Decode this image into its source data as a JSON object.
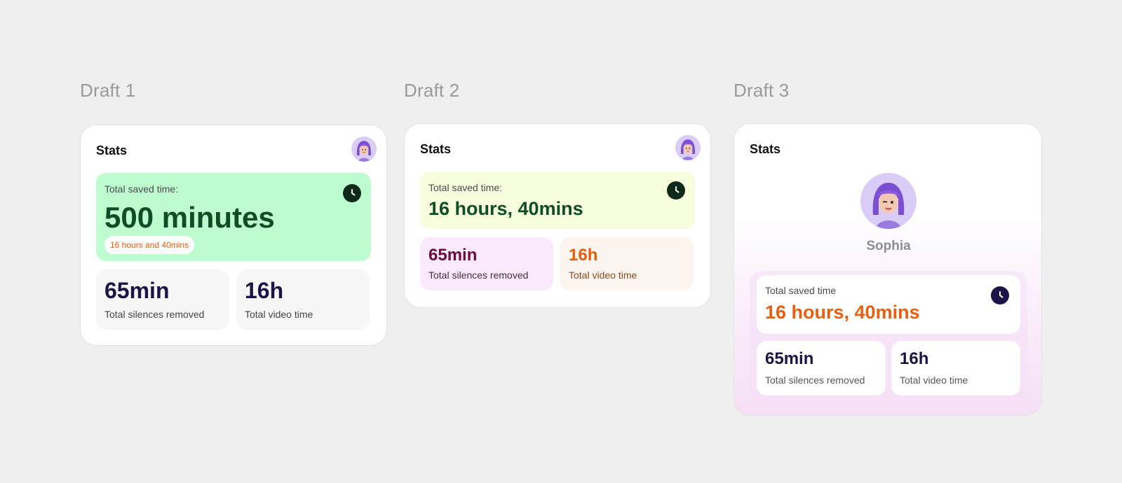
{
  "drafts": [
    {
      "title": "Draft 1",
      "card_title": "Stats",
      "saved_label": "Total saved time:",
      "saved_value": "500 minutes",
      "saved_pill": "16 hours and 40mins",
      "silences_value": "65min",
      "silences_label": "Total silences removed",
      "video_value": "16h",
      "video_label": "Total video time"
    },
    {
      "title": "Draft 2",
      "card_title": "Stats",
      "saved_label": "Total saved time:",
      "saved_value": "16 hours, 40mins",
      "silences_value": "65min",
      "silences_label": "Total silences removed",
      "video_value": "16h",
      "video_label": "Total video time"
    },
    {
      "title": "Draft 3",
      "card_title": "Stats",
      "user_name": "Sophia",
      "saved_label": "Total saved time",
      "saved_value": "16 hours, 40mins",
      "silences_value": "65min",
      "silences_label": "Total silences removed",
      "video_value": "16h",
      "video_label": "Total video time"
    }
  ],
  "colors": {
    "background": "#efefef",
    "draft1_saved_bg": "#bdfdd0",
    "draft2_saved_bg": "#f6fedd",
    "accent_orange": "#e8600f",
    "dark_green": "#0f4d26",
    "navy": "#1b1547"
  },
  "icons": {
    "clock": "clock-icon",
    "avatar": "avatar-memoji"
  }
}
